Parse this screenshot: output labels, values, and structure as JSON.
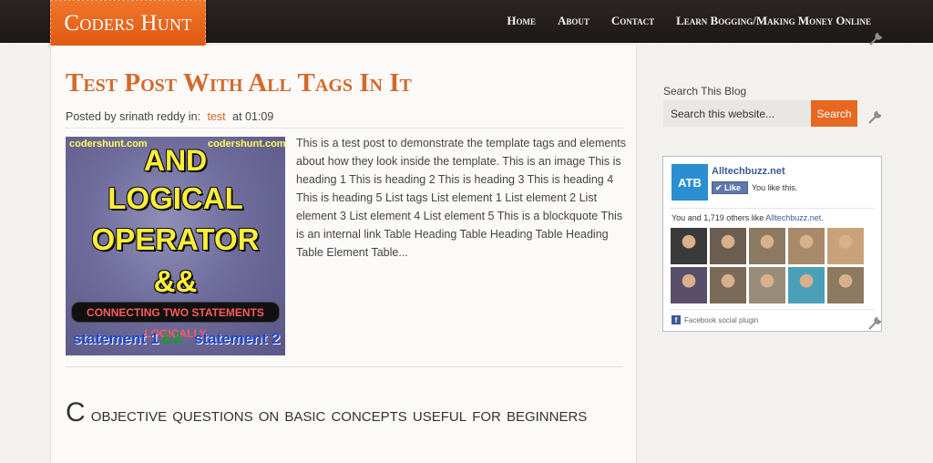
{
  "header": {
    "logo": "Coders Hunt",
    "nav": [
      "Home",
      "About",
      "Contact",
      "Learn Bogging/Making Money Online"
    ]
  },
  "post": {
    "title": "Test Post With All Tags In It",
    "meta_prefix": "Posted by srinath reddy in:",
    "tag": "test",
    "meta_suffix": "at 01:09",
    "thumbnail": {
      "site_left": "codershunt.com",
      "site_right": "codershunt.com",
      "line1": "AND",
      "line2": "LOGICAL",
      "line3": "OPERATOR",
      "line4": "&&",
      "banner": "CONNECTING TWO STATEMENTS LOGICALLY",
      "stmt1": "statement 1",
      "amp": "&&",
      "stmt2": "statement 2"
    },
    "excerpt": "This is a test post to demonstrate the template tags and elements about how they look inside the template. This is an image This is heading 1 This is heading 2 This is heading 3 This is heading 4 This is heading 5 List tags List element 1 List element 2 List element 3 List element 4 List element 5 This is a blockquote This is an internal link Table Heading Table Heading Table Heading Table Element Table..."
  },
  "post2": {
    "title_cap": "C",
    "title_rest": " objective questions on basic concepts useful for beginners"
  },
  "sidebar": {
    "search_title": "Search This Blog",
    "search_placeholder": "Search this website...",
    "search_button": "Search",
    "facebook": {
      "logo": "ATB",
      "page_name": "Alltechbuzz.net",
      "like_button": "Like",
      "you_like": "You like this.",
      "count_text": "You and 1,719 others like ",
      "count_link": "Alltechbuzz.net.",
      "plugin_label": "Facebook social plugin",
      "face_colors": [
        "#3a3a3a",
        "#6b5d4f",
        "#8a7a62",
        "#a88a6a",
        "#c9a27a",
        "#5a4f6a",
        "#7a6a58",
        "#9a8c7a",
        "#4aa0b8",
        "#8b7a60"
      ]
    }
  }
}
